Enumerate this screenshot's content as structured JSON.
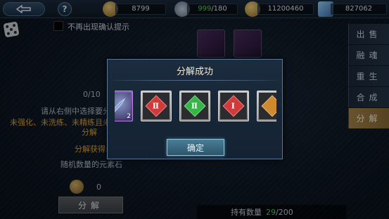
{
  "topbar": {
    "back_icon": "back-arrow-icon",
    "help_label": "?",
    "resources": [
      {
        "name": "gold-coins",
        "value": "8799"
      },
      {
        "name": "stamina",
        "value_current": "999",
        "value_max": "/180"
      },
      {
        "name": "silver-coins",
        "value": "11200460"
      },
      {
        "name": "crystals",
        "value": "827062"
      }
    ]
  },
  "left_panel": {
    "checkbox_label": "不再出现确认提示",
    "count": "0/10",
    "instruction": "请从右侧中选择要分",
    "condition_line1": "未强化、未洗练、未精练且未",
    "condition_line2": "分解",
    "gain_label": "分解获得:",
    "gain_item": "随机数量的元素石",
    "cost_value": "0",
    "decompose_button": "分解"
  },
  "tabs": [
    {
      "label": "出售",
      "active": false
    },
    {
      "label": "融魂",
      "active": false
    },
    {
      "label": "重生",
      "active": false
    },
    {
      "label": "合成",
      "active": false
    },
    {
      "label": "分解",
      "active": true
    }
  ],
  "holding": {
    "label": "持有数量",
    "current": "29",
    "max": "/200"
  },
  "dialog": {
    "title": "分解成功",
    "items": [
      {
        "kind": "purple-item",
        "badge": "2"
      },
      {
        "kind": "red-gem",
        "glyph": "Ⅱ",
        "color": "#d23a3a"
      },
      {
        "kind": "green-gem",
        "glyph": "Ⅱ",
        "color": "#34b545"
      },
      {
        "kind": "red-gem",
        "glyph": "Ⅰ",
        "color": "#d23a3a"
      },
      {
        "kind": "orange-gem",
        "glyph": "",
        "color": "#d08a2e"
      }
    ],
    "confirm_button": "确定"
  }
}
